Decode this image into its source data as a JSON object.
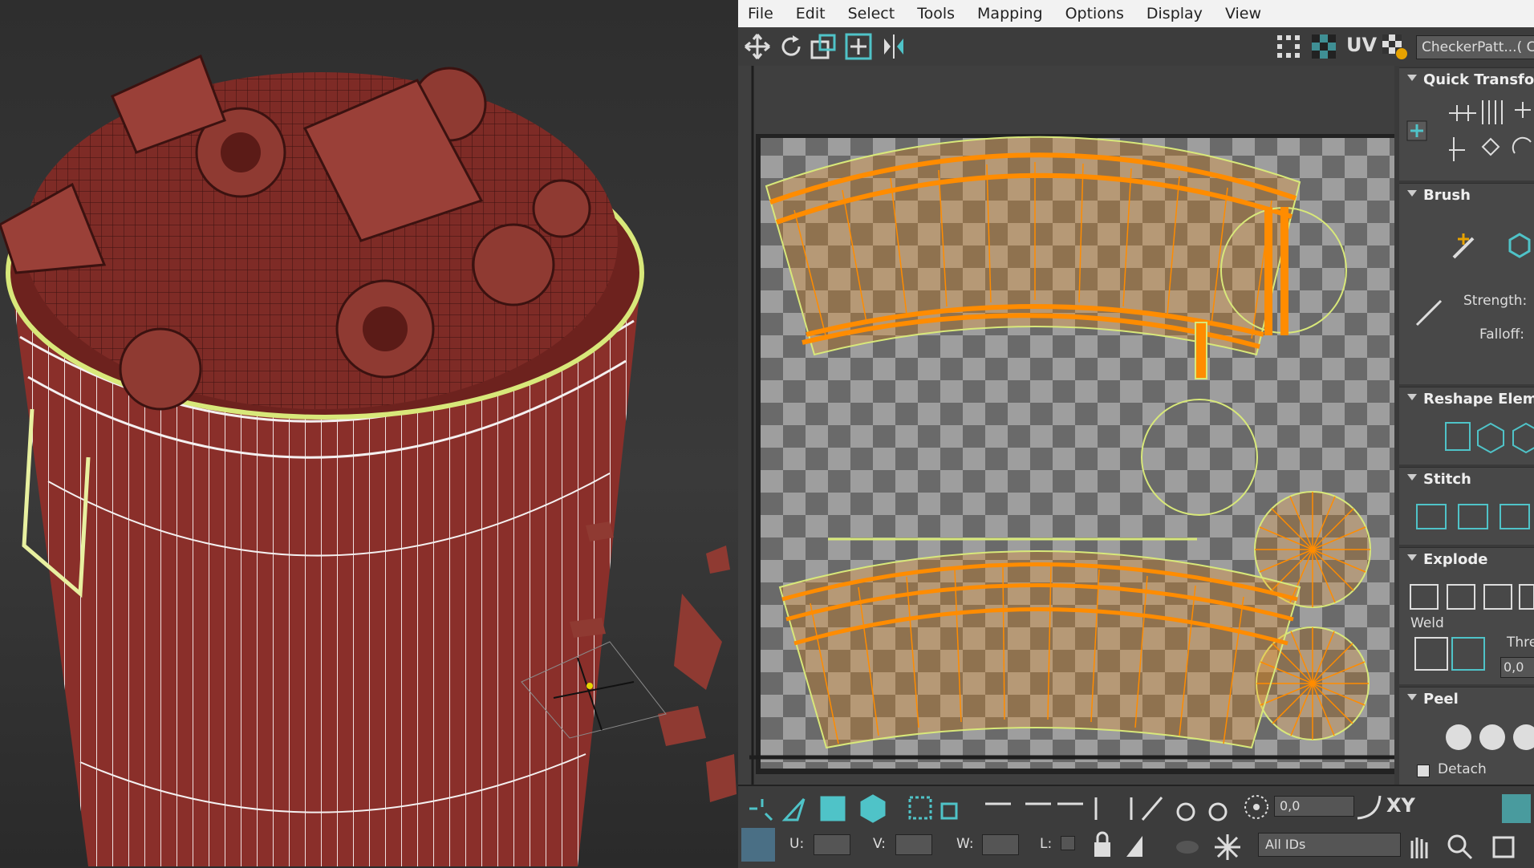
{
  "menu": [
    "File",
    "Edit",
    "Select",
    "Tools",
    "Mapping",
    "Options",
    "Display",
    "View"
  ],
  "toolbar": {
    "uv_label": "UV",
    "texture_dropdown": "CheckerPatt...( Ch"
  },
  "panels": {
    "quick_transform": "Quick Transform",
    "brush": "Brush",
    "strength_label": "Strength:",
    "falloff_label": "Falloff:",
    "reshape": "Reshape Elemen",
    "stitch": "Stitch",
    "explode": "Explode",
    "weld_label": "Weld",
    "threshold_label": "Thre",
    "threshold_value": "0,0",
    "peel": "Peel",
    "detach_label": "Detach"
  },
  "bottom": {
    "u_label": "U:",
    "v_label": "V:",
    "w_label": "W:",
    "l_label": "L:",
    "spinner_value": "0,0",
    "xy_label": "XY",
    "ids_dropdown": "All IDs"
  },
  "colors": {
    "uv_orange": "#ff8c00",
    "uv_border": "#d8e87a",
    "panel_bg": "#3c3c3c",
    "mesh_red": "#8f3a32"
  }
}
